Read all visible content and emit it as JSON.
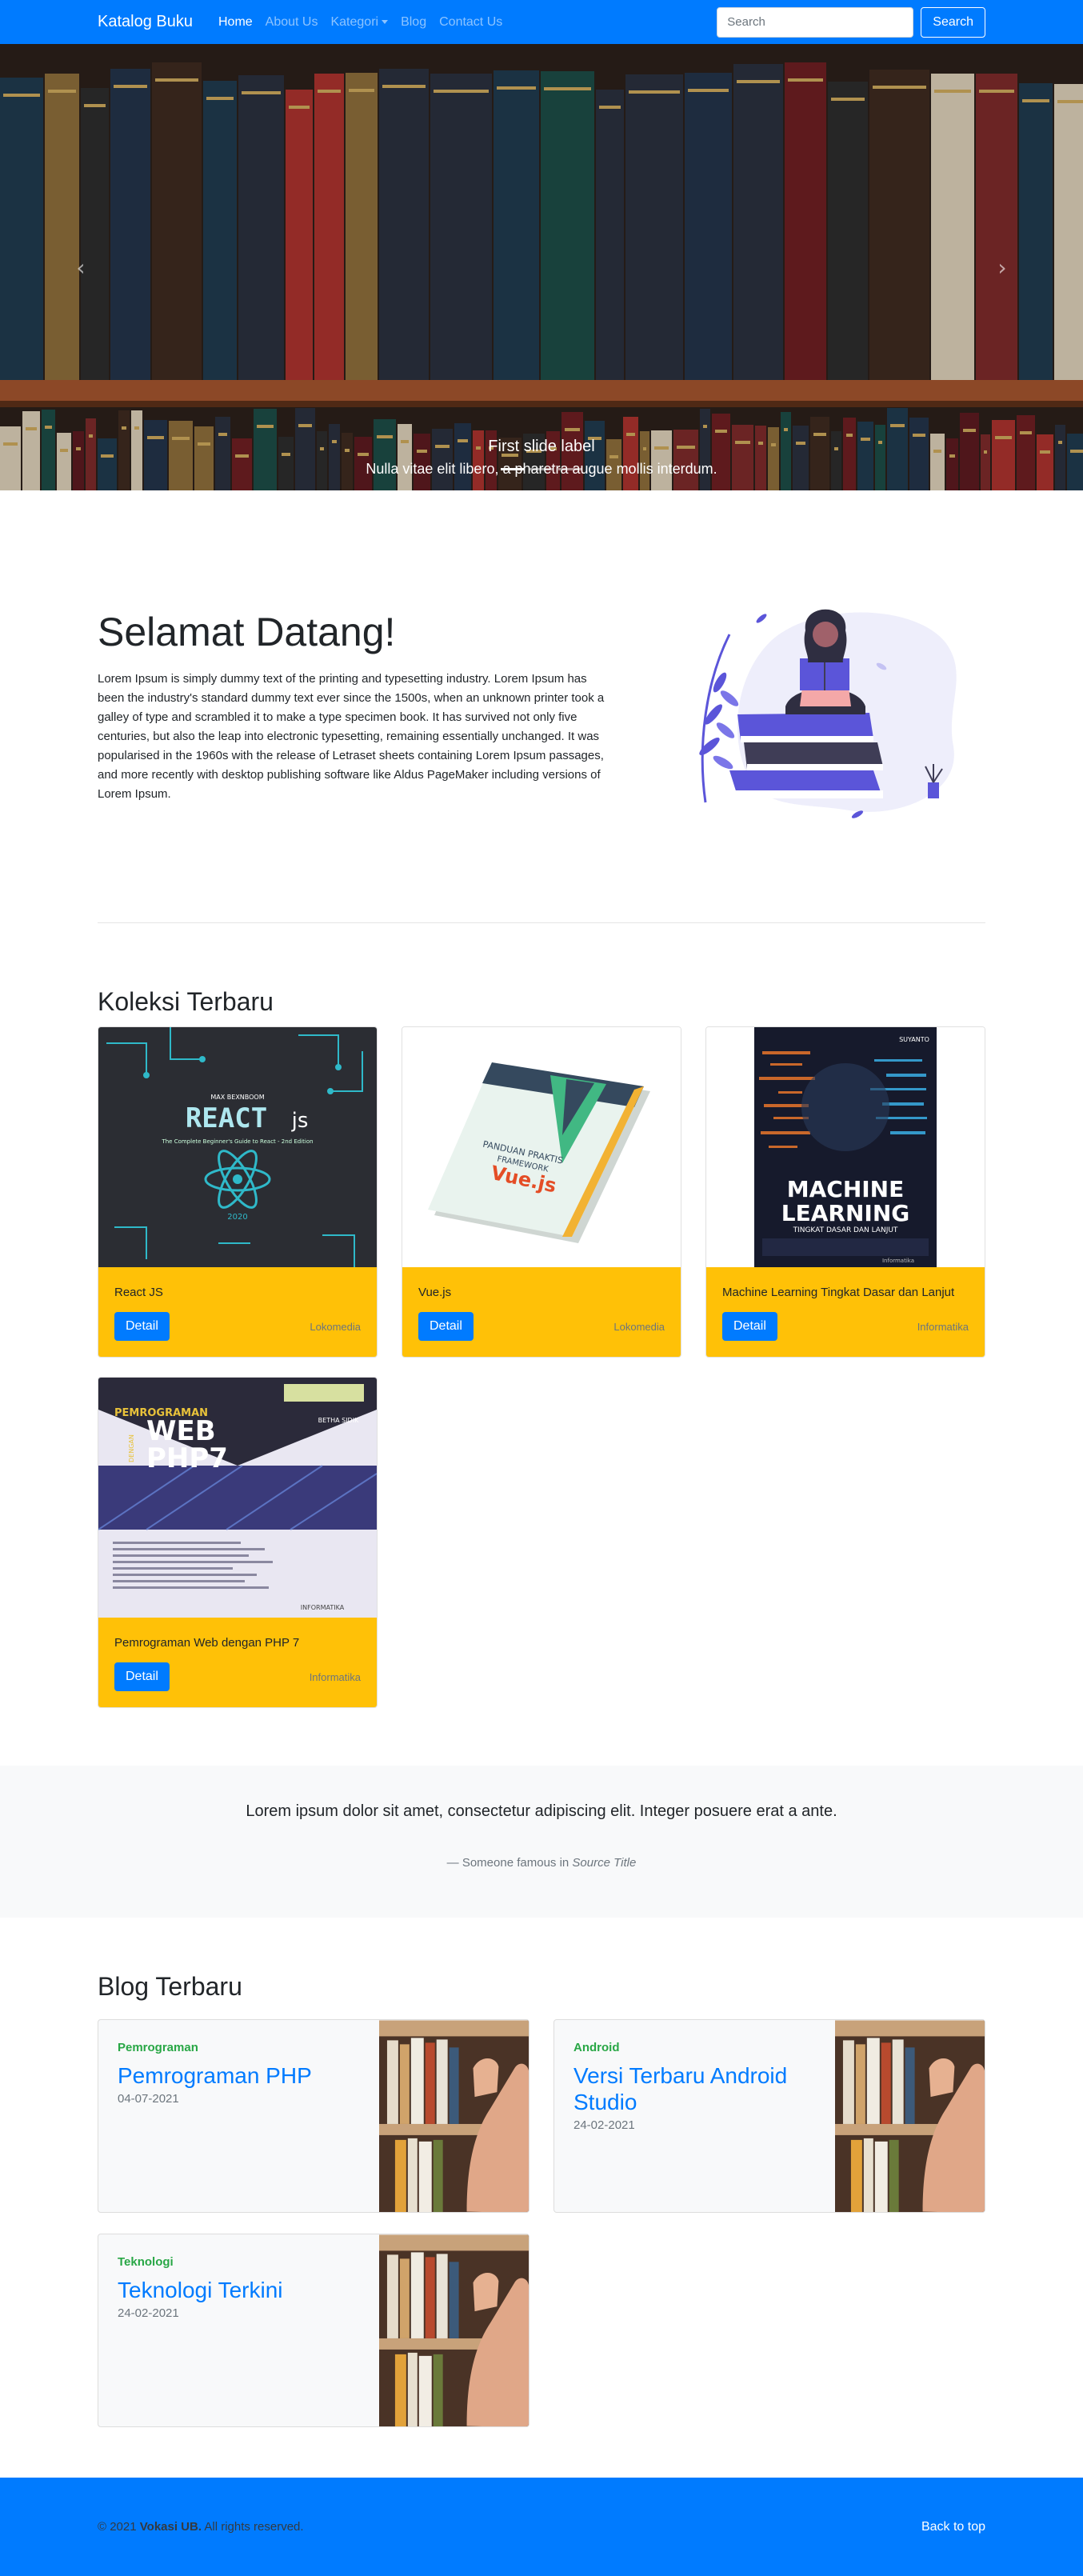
{
  "navbar": {
    "brand": "Katalog Buku",
    "links": [
      {
        "label": "Home",
        "active": true
      },
      {
        "label": "About Us"
      },
      {
        "label": "Kategori"
      },
      {
        "label": "Blog"
      },
      {
        "label": "Contact Us"
      }
    ],
    "search_placeholder": "Search",
    "search_button": "Search",
    "color": "#007bff"
  },
  "carousel": {
    "prev_icon": "chevron-left-icon",
    "next_icon": "chevron-right-icon",
    "caption_title": "First slide label",
    "caption_text": "Nulla vitae elit libero, a pharetra augue mollis interdum.",
    "slide_count": 3,
    "active_slide": 1
  },
  "welcome": {
    "title": "Selamat Datang!",
    "text": "Lorem Ipsum is simply dummy text of the printing and typesetting industry. Lorem Ipsum has been the industry's standard dummy text ever since the 1500s, when an unknown printer took a galley of type and scrambled it to make a type specimen book. It has survived not only five centuries, but also the leap into electronic typesetting, remaining essentially unchanged. It was popularised in the 1960s with the release of Letraset sheets containing Lorem Ipsum passages, and more recently with desktop publishing software like Aldus PageMaker including versions of Lorem Ipsum."
  },
  "koleksi": {
    "title": "Koleksi Terbaru",
    "detail_label": "Detail",
    "books": [
      {
        "title": "React JS",
        "publisher": "Lokomedia"
      },
      {
        "title": "Vue.js",
        "publisher": "Lokomedia"
      },
      {
        "title": "Machine Learning Tingkat Dasar dan Lanjut",
        "publisher": "Informatika"
      },
      {
        "title": "Pemrograman Web dengan PHP 7",
        "publisher": "Informatika"
      }
    ],
    "cover_text": {
      "react_author": "MAX BEXNBOOM",
      "react_word": "REACT",
      "react_js": "js",
      "react_sub": "The Complete Beginner's Guide to React - 2nd Edition",
      "react_year": "2020",
      "vue_lines": [
        "PANDUAN PRAKTIS",
        "FRAMEWORK"
      ],
      "vue_word": "Vue.js",
      "ml_author": "SUYANTO",
      "ml_l1": "MACHINE",
      "ml_l2": "LEARNING",
      "ml_sub": "TINGKAT DASAR DAN LANJUT",
      "ml_pub": "Informatika",
      "php_l1": "PEMROGRAMAN",
      "php_l2": "WEB",
      "php_l3": "PHP7",
      "php_dengan": "DENGAN",
      "php_author": "BETHA SIDIK",
      "php_pub": "INFORMATIKA"
    },
    "card_color": "#ffc107"
  },
  "quote": {
    "text": "Lorem ipsum dolor sit amet, consectetur adipiscing elit. Integer posuere erat a ante.",
    "author": "— Someone famous in",
    "source": "Source Title"
  },
  "blog": {
    "title": "Blog Terbaru",
    "posts": [
      {
        "category": "Pemrograman",
        "title": "Pemrograman PHP",
        "date": "04-07-2021"
      },
      {
        "category": "Android",
        "title": "Versi Terbaru Android Studio",
        "date": "24-02-2021"
      },
      {
        "category": "Teknologi",
        "title": "Teknologi Terkini",
        "date": "24-02-2021"
      }
    ]
  },
  "footer": {
    "copyright_year": "© 2021",
    "copyright_owner": "Vokasi UB.",
    "copyright_rest": "All rights reserved.",
    "back_to_top": "Back to top"
  }
}
